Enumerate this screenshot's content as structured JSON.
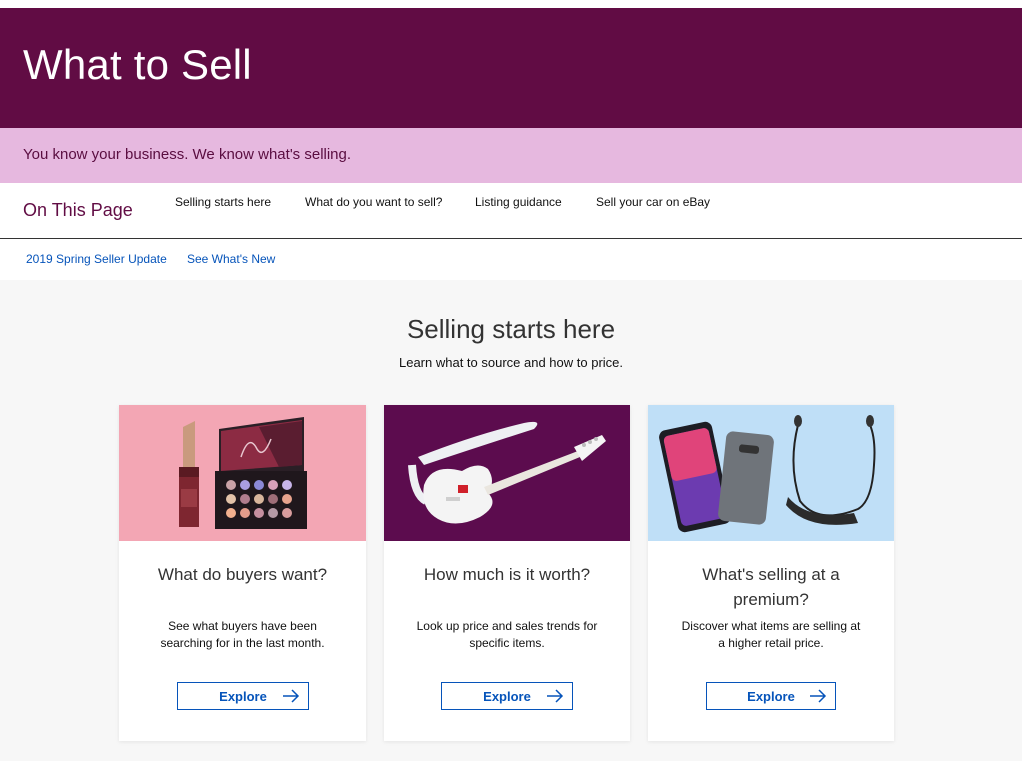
{
  "hero": {
    "title": "What to Sell"
  },
  "tagline": "You know your business. We know what's selling.",
  "on_this_page": {
    "label": "On This Page",
    "links": [
      "Selling starts here",
      "What do you want to sell?",
      "Listing guidance",
      "Sell your car on eBay"
    ]
  },
  "updates": {
    "spring_update": "2019 Spring Seller Update",
    "see_new": "See What's New"
  },
  "section": {
    "title": "Selling starts here",
    "subtitle": "Learn what to source and how to price."
  },
  "cards": [
    {
      "title": "What do buyers want?",
      "description": "See what buyers have been searching for in the last month.",
      "button": "Explore",
      "image_bg": "#f3a6b4"
    },
    {
      "title": "How much is it worth?",
      "description": "Look up price and sales trends for specific items.",
      "button": "Explore",
      "image_bg": "#5c0c4e"
    },
    {
      "title": "What's selling at a premium?",
      "description": "Discover what items are selling at a higher retail price.",
      "button": "Explore",
      "image_bg": "#bfdff7"
    }
  ],
  "colors": {
    "brand": "#610c44",
    "tagline_bg": "#e6b8df",
    "link": "#0654ba"
  }
}
